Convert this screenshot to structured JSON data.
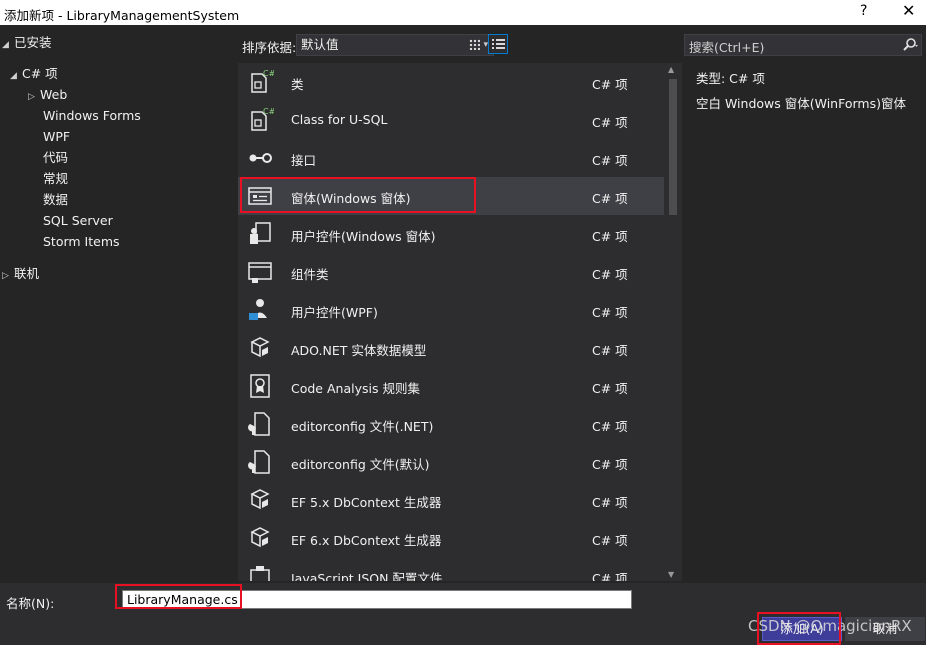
{
  "window": {
    "title": "添加新项 - LibraryManagementSystem",
    "help": "?",
    "close": "✕"
  },
  "tree": {
    "installed": "已安装",
    "csharp": "C# 项",
    "items": [
      "Web",
      "Windows Forms",
      "WPF",
      "代码",
      "常规",
      "数据",
      "SQL Server",
      "Storm Items"
    ],
    "online": "联机"
  },
  "toolbar": {
    "sort_label": "排序依据:",
    "sort_value": "默认值",
    "sort_arrow": "▾",
    "views": [
      "grid-view",
      "list-view"
    ]
  },
  "templates": [
    {
      "name": "类",
      "lang": "C# 项",
      "icon": "class-cs-icon"
    },
    {
      "name": "Class for U-SQL",
      "lang": "C# 项",
      "icon": "class-cs-icon"
    },
    {
      "name": "接口",
      "lang": "C# 项",
      "icon": "interface-icon"
    },
    {
      "name": "窗体(Windows 窗体)",
      "lang": "C# 项",
      "icon": "form-icon",
      "selected": true
    },
    {
      "name": "用户控件(Windows 窗体)",
      "lang": "C# 项",
      "icon": "user-control-icon"
    },
    {
      "name": "组件类",
      "lang": "C# 项",
      "icon": "component-icon"
    },
    {
      "name": "用户控件(WPF)",
      "lang": "C# 项",
      "icon": "wpf-user-control-icon"
    },
    {
      "name": "ADO.NET 实体数据模型",
      "lang": "C# 项",
      "icon": "data-model-icon"
    },
    {
      "name": "Code Analysis 规则集",
      "lang": "C# 项",
      "icon": "ruleset-icon"
    },
    {
      "name": "editorconfig 文件(.NET)",
      "lang": "C# 项",
      "icon": "editorconfig-icon"
    },
    {
      "name": "editorconfig 文件(默认)",
      "lang": "C# 项",
      "icon": "editorconfig-icon"
    },
    {
      "name": "EF 5.x DbContext 生成器",
      "lang": "C# 项",
      "icon": "data-model-icon"
    },
    {
      "name": "EF 6.x DbContext 生成器",
      "lang": "C# 项",
      "icon": "data-model-icon"
    },
    {
      "name": "JavaScript JSON 配置文件",
      "lang": "C# 项",
      "icon": "json-config-icon"
    }
  ],
  "search": {
    "placeholder": "搜索(Ctrl+E)"
  },
  "details": {
    "type_line": "类型:  C# 项",
    "description": "空白 Windows 窗体(WinForms)窗体"
  },
  "bottom": {
    "name_label": "名称(N):",
    "name_value": "LibraryManage.cs",
    "add": "添加(A)",
    "cancel": "取消"
  },
  "watermark": "CSDN @QmagicianRX",
  "colors": {
    "highlight": "#e81123",
    "selected_row": "#3f3f46",
    "accent": "#007acc"
  }
}
